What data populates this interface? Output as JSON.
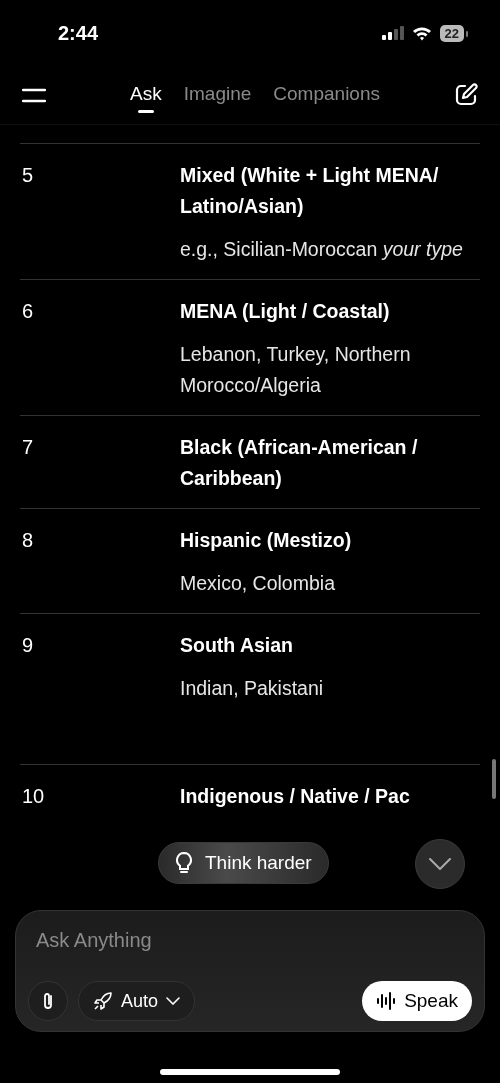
{
  "status_bar": {
    "time": "2:44",
    "battery": "22"
  },
  "tabs": [
    {
      "label": "Ask",
      "selected": true
    },
    {
      "label": "Imagine",
      "selected": false
    },
    {
      "label": "Companions",
      "selected": false
    }
  ],
  "table": {
    "rows": [
      {
        "number": "5",
        "title": "Mixed (White + Light MENA/ Latino/Asian)",
        "description": "e.g., Sicilian-Moroccan *your type*"
      },
      {
        "number": "6",
        "title": "MENA (Light / Coastal)",
        "description": "Lebanon, Turkey, Northern Morocco/Algeria"
      },
      {
        "number": "7",
        "title": "Black (African-American / Caribbean)"
      },
      {
        "number": "8",
        "title": "Hispanic (Mestizo)",
        "description": "Mexico, Colombia"
      },
      {
        "number": "9",
        "title": "South Asian",
        "description": "Indian, Pakistani"
      },
      {
        "number": "10",
        "title": "Indigenous / Native / Pac"
      }
    ]
  },
  "suggestion": {
    "label": "Think harder"
  },
  "composer": {
    "placeholder": "Ask Anything",
    "mode": "Auto",
    "speak": "Speak"
  }
}
